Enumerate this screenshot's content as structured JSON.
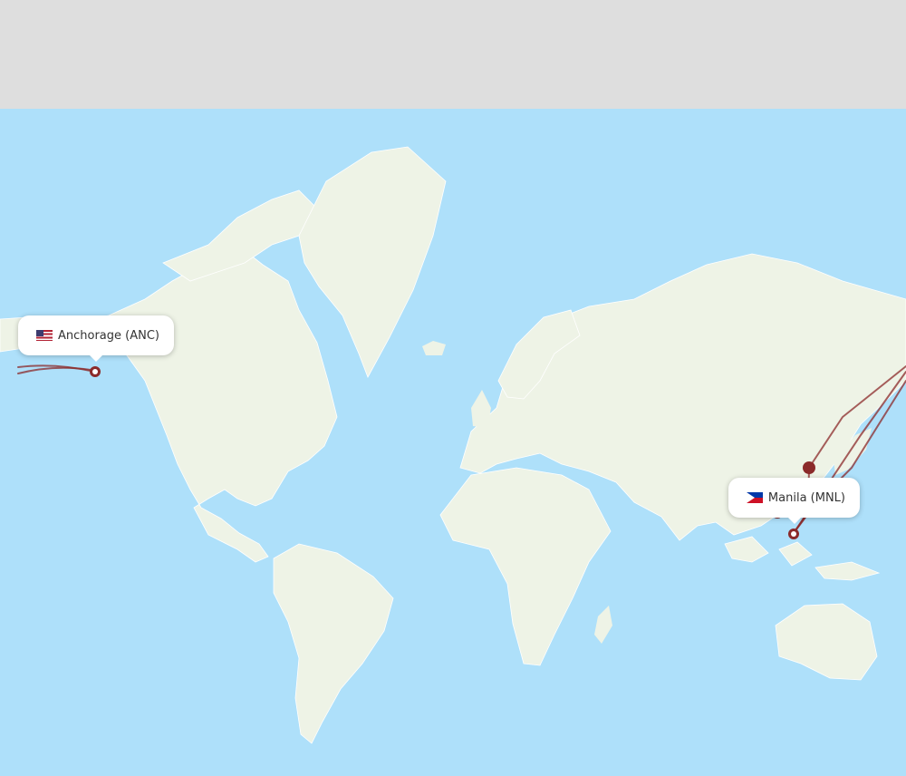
{
  "map": {
    "origin": {
      "label": "Anchorage (ANC)",
      "flag_icon": "us-flag-icon"
    },
    "destination": {
      "label": "Manila (MNL)",
      "flag_icon": "philippines-flag-icon"
    },
    "colors": {
      "ocean": "#aee0fa",
      "land": "#eef3e6",
      "route": "#8b2a2a",
      "background": "#dedede"
    }
  }
}
